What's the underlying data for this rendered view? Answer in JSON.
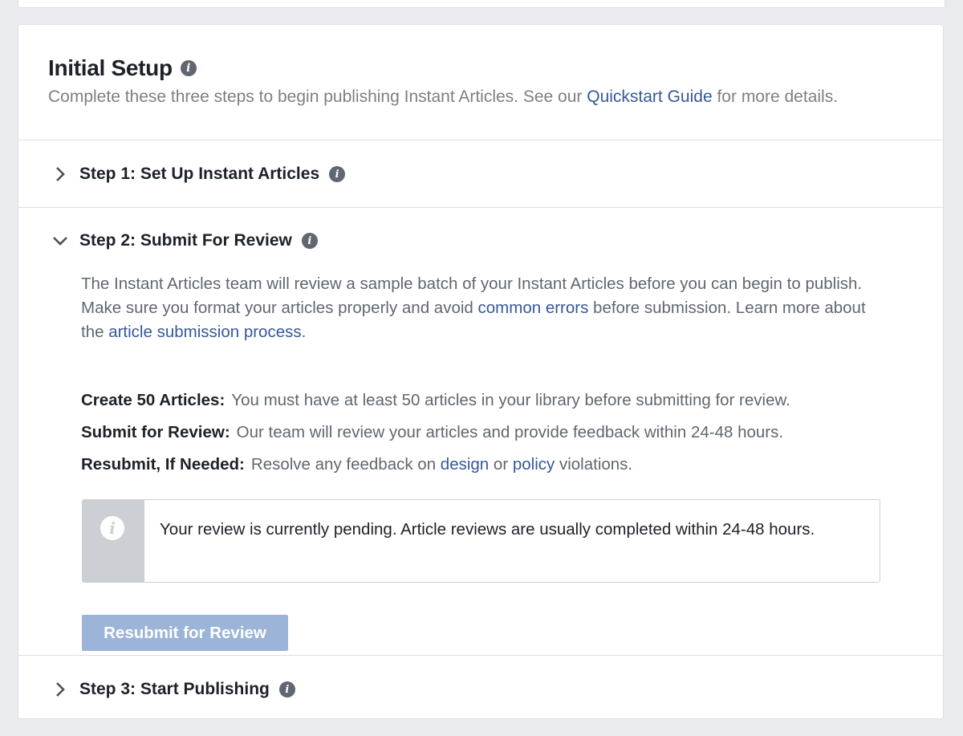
{
  "header": {
    "title": "Initial Setup",
    "subtitle_before": "Complete these three steps to begin publishing Instant Articles. See our ",
    "subtitle_link": "Quickstart Guide",
    "subtitle_after": " for more details."
  },
  "steps": [
    {
      "label": "Step 1: Set Up Instant Articles",
      "expanded": false
    },
    {
      "label": "Step 2: Submit For Review",
      "expanded": true
    },
    {
      "label": "Step 3: Start Publishing",
      "expanded": false
    }
  ],
  "step2": {
    "desc_part1": "The Instant Articles team will review a sample batch of your Instant Articles before you can begin to publish. Make sure you format your articles properly and avoid ",
    "desc_link1": "common errors",
    "desc_part2": " before submission. Learn more about the ",
    "desc_link2": "article submission process",
    "desc_part3": ".",
    "requirements": [
      {
        "label": "Create 50 Articles:",
        "text": "You must have at least 50 articles in your library before submitting for review."
      },
      {
        "label": "Submit for Review:",
        "text": "Our team will review your articles and provide feedback within 24-48 hours."
      },
      {
        "label": "Resubmit, If Needed:",
        "text_before": "Resolve any feedback on ",
        "link1": "design",
        "text_mid": " or ",
        "link2": "policy",
        "text_after": " violations."
      }
    ],
    "notice": "Your review is currently pending. Article reviews are usually completed within 24-48 hours.",
    "button_label": "Resubmit for Review"
  },
  "icons": {
    "info": "info-icon",
    "chevron_right": "chevron-right-icon",
    "chevron_down": "chevron-down-icon"
  },
  "colors": {
    "link": "#365899",
    "button_disabled": "#9cb4d8",
    "border": "#dddfe2"
  }
}
